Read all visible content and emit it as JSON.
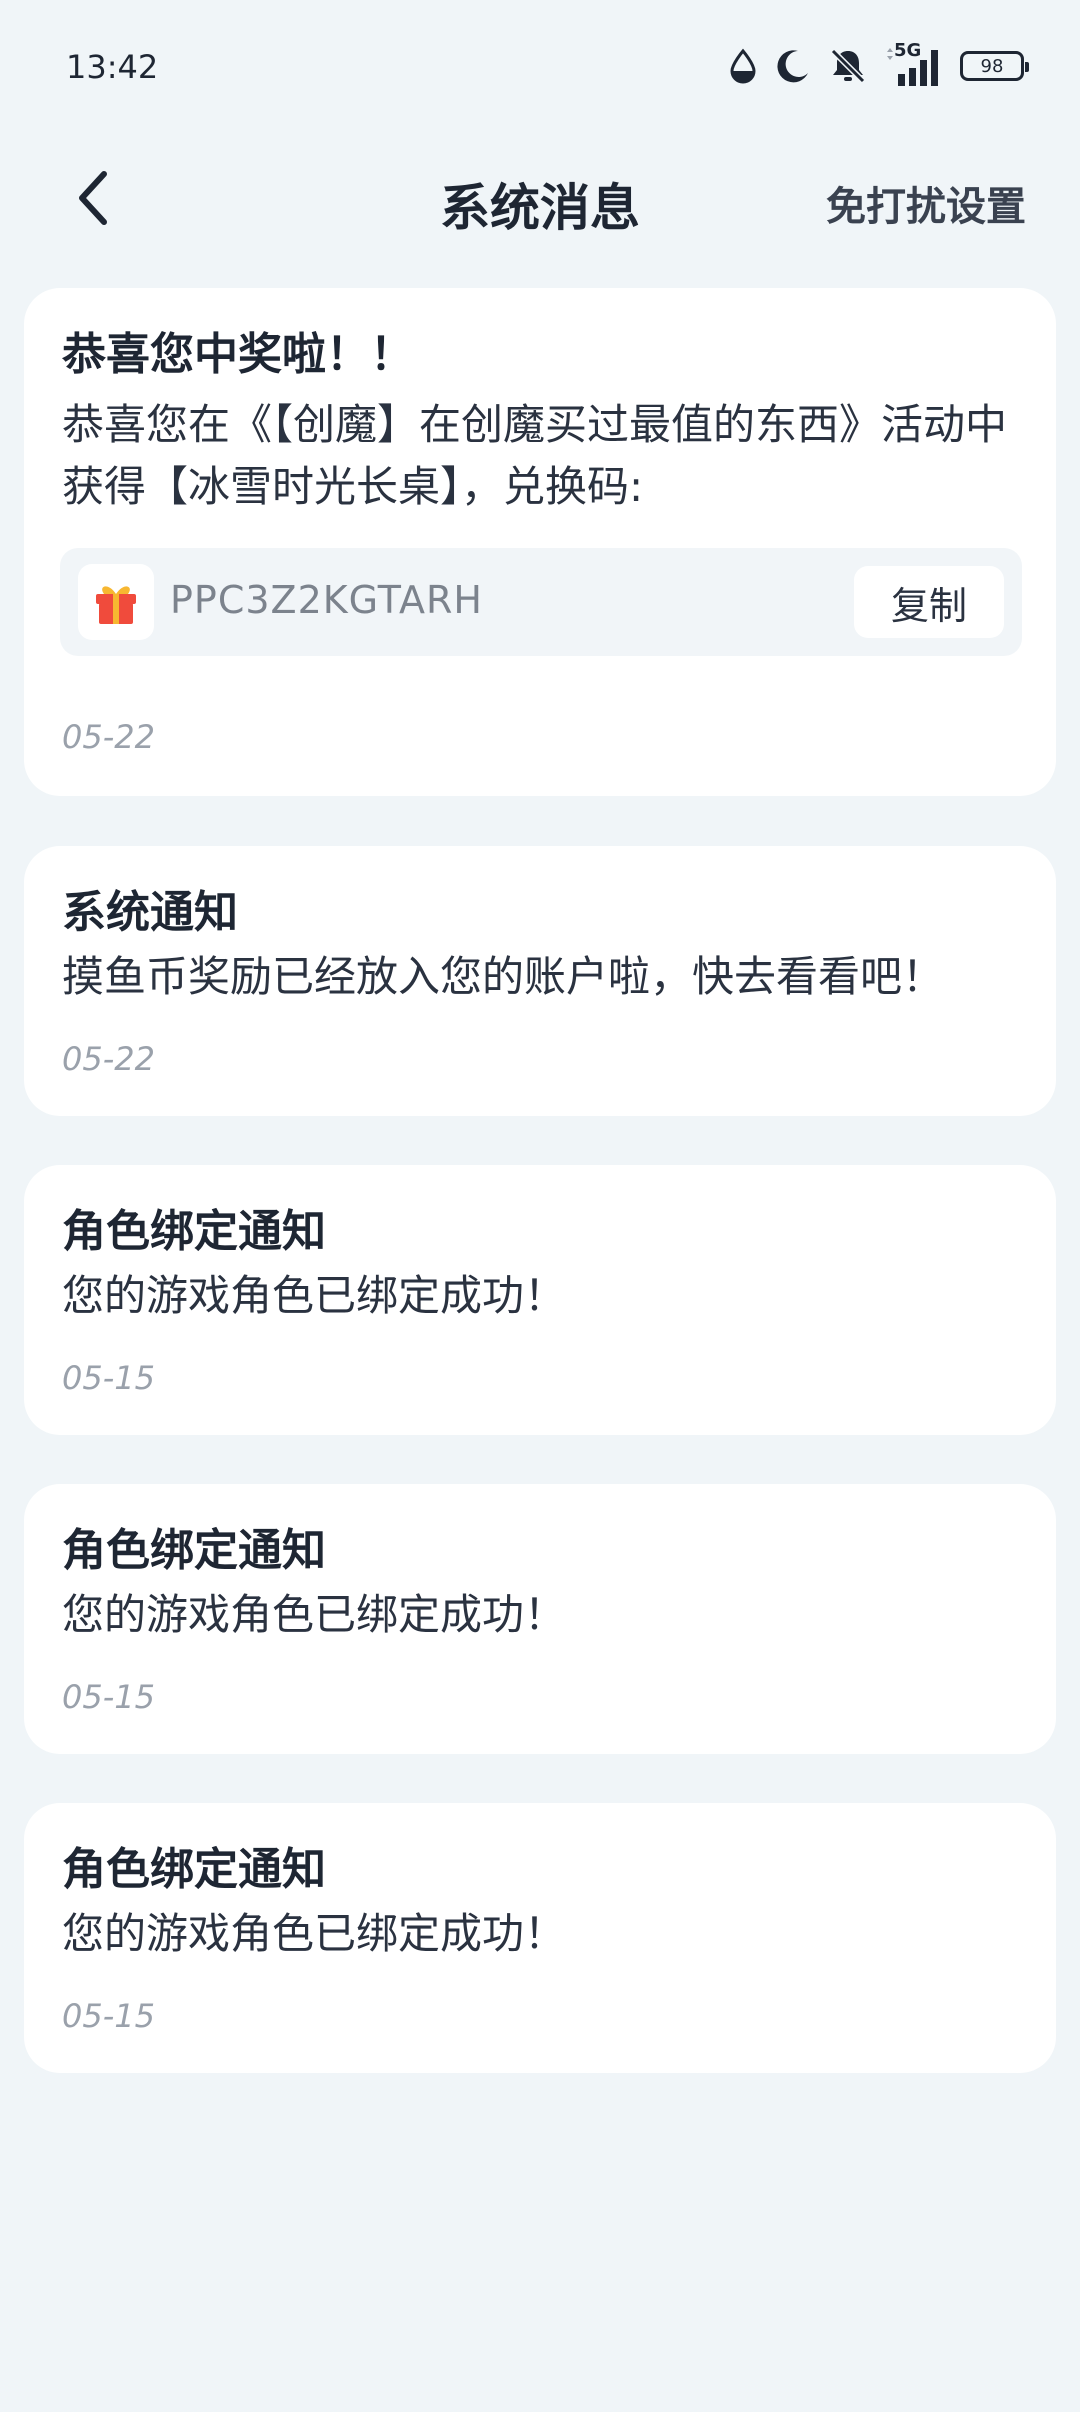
{
  "status_bar": {
    "time": "13:42",
    "network": "5G",
    "battery": "98",
    "icons": [
      "water-drop-icon",
      "moon-icon",
      "bell-off-icon",
      "signal-icon",
      "battery-icon"
    ]
  },
  "header": {
    "back_icon": "chevron-left-icon",
    "title": "系统消息",
    "dnd_label": "免打扰设置"
  },
  "messages": [
    {
      "title": "恭喜您中奖啦！！",
      "body": "恭喜您在《【创魔】在创魔买过最值的东西》活动中获得【冰雪时光长桌】，兑换码:",
      "code": "PPC3Z2KGTARH",
      "copy_label": "复制",
      "gift_icon": "gift-icon",
      "date": "05-22"
    },
    {
      "title": "系统通知",
      "body": "摸鱼币奖励已经放入您的账户啦，快去看看吧！",
      "date": "05-22"
    },
    {
      "title": "角色绑定通知",
      "body": "您的游戏角色已绑定成功！",
      "date": "05-15"
    },
    {
      "title": "角色绑定通知",
      "body": "您的游戏角色已绑定成功！",
      "date": "05-15"
    },
    {
      "title": "角色绑定通知",
      "body": "您的游戏角色已绑定成功！",
      "date": "05-15"
    }
  ],
  "colors": {
    "background": "#f0f5f8",
    "card": "#ffffff",
    "text_primary": "#1e2633",
    "text_date": "#9aa1ab",
    "gift_red": "#f04b3c",
    "gift_ribbon": "#f7b731"
  }
}
